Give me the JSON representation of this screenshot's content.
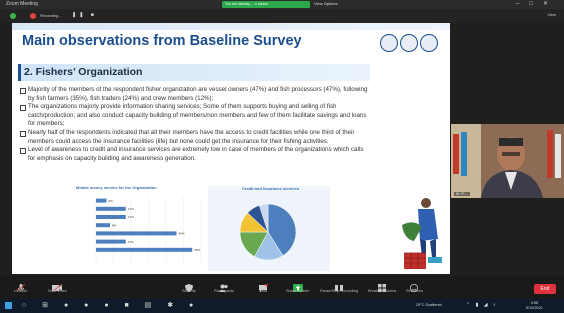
{
  "window": {
    "title": "Zoom Meeting"
  },
  "share_banner": "You are viewing ....'s screen",
  "view_options": "View Options",
  "recording": {
    "label": "Recording..."
  },
  "view_button": "View",
  "slide": {
    "title": "Main observations from Baseline Survey",
    "subtitle": "2. Fishers’ Organization",
    "bullets": [
      "Majority of the members of the respondent fisher organization are vessel owners (47%) and fish processors (47%), following by fish farmers (35%), fish traders (24%) and crew members (12%);",
      "The organizations majorly provide information sharing services; Some of them supports buying and selling of fish catch/production; and also conduct capacity building of members/non members and few of them facilitate savings and loans for members;",
      "Nearly half of the respondents indicated that all their members have the access to credit facilities while one third of their members could access the insurance facilities (life) but none could get the insurance for their fishing activities.",
      "Level of awareness to credit and insurance services are extremely low in case of members of the organizations which calls for emphasis on capacity building and awareness generation."
    ]
  },
  "chart_data": [
    {
      "type": "bar",
      "title": "Mobile money service for the Organization",
      "categories": [
        "",
        "",
        "",
        "",
        "",
        "",
        "",
        ""
      ],
      "values": [
        6,
        17,
        17,
        8,
        46,
        17,
        55,
        0
      ],
      "value_labels": [
        "6%",
        "17%",
        "17%",
        "8%",
        "46%",
        "17%",
        "55%",
        ""
      ],
      "xlim": [
        0,
        60
      ]
    },
    {
      "type": "pie",
      "title": "Credit and Insurance services",
      "values": [
        41,
        17,
        17,
        12,
        8,
        5
      ],
      "colors": [
        "#4d7fbf",
        "#9ec3e6",
        "#6aa84f",
        "#f1c232",
        "#2f5597",
        "#c6d9f0"
      ],
      "annotations": [
        "",
        "",
        "",
        "",
        "",
        ""
      ]
    }
  ],
  "participant": {
    "name": "",
    "caption": "Dr. P....."
  },
  "toolbar": {
    "items": [
      {
        "label": "Unmute",
        "icon": "microphone-icon"
      },
      {
        "label": "Start Video",
        "icon": "camera-icon"
      },
      {
        "label": "Security",
        "icon": "shield-icon"
      },
      {
        "label": "Participants",
        "icon": "people-icon"
      },
      {
        "label": "Chat",
        "icon": "chat-icon"
      },
      {
        "label": "Share Screen",
        "icon": "share-screen-icon"
      },
      {
        "label": "Pause/Stop Recording",
        "icon": "record-icon"
      },
      {
        "label": "Breakout Rooms",
        "icon": "grid-icon"
      },
      {
        "label": "Reactions",
        "icon": "smile-icon"
      }
    ],
    "end_label": "End"
  },
  "taskbar": {
    "weather": "29°C Scattered",
    "time": "0:58",
    "date": "9/19/2021"
  }
}
